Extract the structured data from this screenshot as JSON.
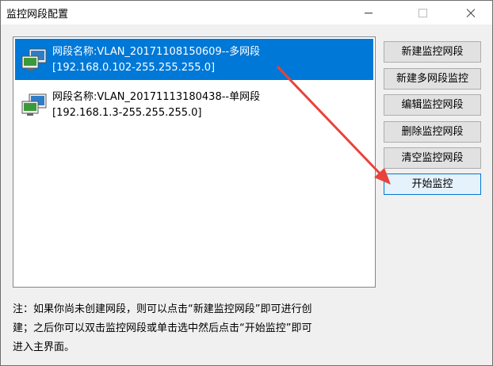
{
  "window": {
    "title": "监控网段配置"
  },
  "list": {
    "items": [
      {
        "name_line": "网段名称:VLAN_20171108150609--多网段",
        "range_line": "[192.168.0.102-255.255.255.0]",
        "selected": true
      },
      {
        "name_line": "网段名称:VLAN_20171113180438--单网段",
        "range_line": "[192.168.1.3-255.255.255.0]",
        "selected": false
      }
    ]
  },
  "buttons": {
    "new_monitor_segment": "新建监控网段",
    "new_multi_segment": "新建多网段监控",
    "edit_segment": "编辑监控网段",
    "delete_segment": "删除监控网段",
    "clear_segments": "清空监控网段",
    "start_monitor": "开始监控"
  },
  "note": {
    "line1": "注：如果你尚未创建网段，则可以点击“新建监控网段”即可进行创",
    "line2": "建；之后你可以双击监控网段或单击选中然后点击“开始监控”即可",
    "line3": "进入主界面。"
  },
  "colors": {
    "selection": "#0078d7",
    "annotation_arrow": "#e8433a"
  }
}
